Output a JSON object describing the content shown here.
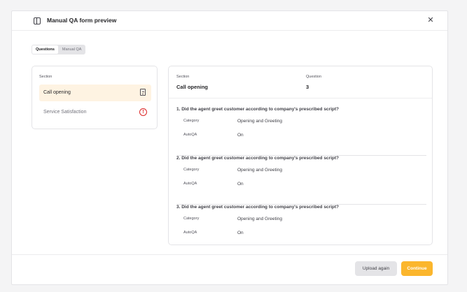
{
  "header": {
    "title": "Manual QA form preview",
    "panel_icon": "sidebar-panel-icon",
    "close_icon": "close-icon",
    "close_glyph": "✕"
  },
  "tabs": [
    {
      "label": "Questions",
      "active": true
    },
    {
      "label": "Manual QA",
      "active": false
    }
  ],
  "sections": {
    "label": "Section",
    "items": [
      {
        "name": "Call opening",
        "selected": true,
        "icon": "document-icon"
      },
      {
        "name": "Service Satisfaction",
        "selected": false,
        "icon": "alert-circle-icon",
        "icon_glyph": "!"
      }
    ]
  },
  "detail": {
    "section_label": "Section",
    "section_value": "Call opening",
    "question_label": "Question",
    "question_value": "3",
    "questions": [
      {
        "title": "1. Did the agent greet customer according to company's prescribed script?",
        "category_label": "Category",
        "category_value": "Opening and Greeting",
        "autoqa_label": "AutoQA",
        "autoqa_value": "On"
      },
      {
        "title": "2. Did the agent greet customer according to company's prescribed script?",
        "category_label": "Category",
        "category_value": "Opening and Greeting",
        "autoqa_label": "AutoQA",
        "autoqa_value": "On"
      },
      {
        "title": "3. Did the agent greet customer according to company's prescribed script?",
        "category_label": "Category",
        "category_value": "Opening and Greeting",
        "autoqa_label": "AutoQA",
        "autoqa_value": "On"
      }
    ]
  },
  "footer": {
    "upload_again_label": "Upload again",
    "continue_label": "Continue"
  },
  "colors": {
    "accent": "#fbb62d",
    "selected_bg": "#fef3e2",
    "alert": "#dc2626"
  }
}
